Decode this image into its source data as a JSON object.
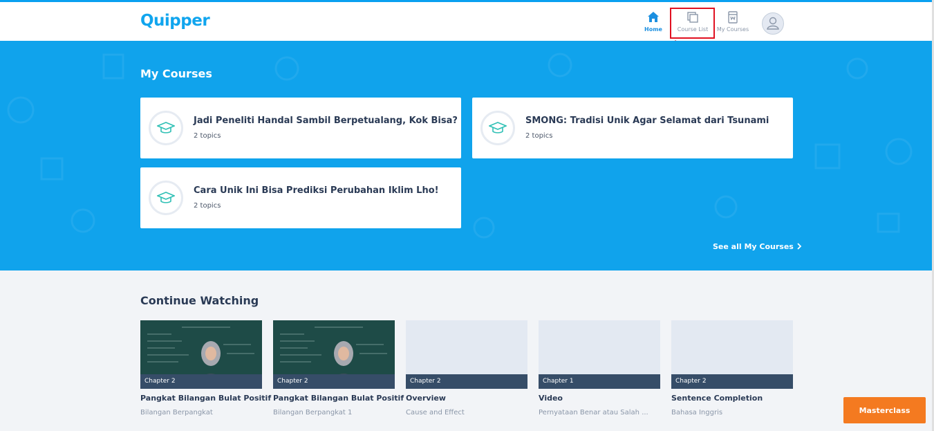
{
  "header": {
    "logo": "Quipper",
    "nav": [
      {
        "label": "Home",
        "icon": "home-icon",
        "active": true
      },
      {
        "label": "Course List",
        "icon": "course-list-icon",
        "highlighted": true
      },
      {
        "label": "My Courses",
        "icon": "my-courses-icon"
      }
    ],
    "avatar_icon": "user-avatar-icon"
  },
  "my_courses": {
    "title": "My Courses",
    "cards": [
      {
        "title": "Jadi Peneliti Handal Sambil Berpetualang, Kok Bisa?",
        "topics": "2 topics",
        "icon": "graduation-cap-icon"
      },
      {
        "title": "SMONG: Tradisi Unik Agar Selamat dari Tsunami",
        "topics": "2 topics",
        "icon": "graduation-cap-icon"
      },
      {
        "title": "Cara Unik Ini Bisa Prediksi Perubahan Iklim Lho!",
        "topics": "2 topics",
        "icon": "graduation-cap-icon"
      }
    ],
    "see_all": "See all My Courses",
    "see_all_icon": "chevron-right-icon"
  },
  "continue_watching": {
    "title": "Continue Watching",
    "videos": [
      {
        "chapter": "Chapter 2",
        "title": "Pangkat Bilangan Bulat Positif",
        "subtitle": "Bilangan Berpangkat",
        "thumbnail": "video-thumbnail"
      },
      {
        "chapter": "Chapter 2",
        "title": "Pangkat Bilangan Bulat Positif",
        "subtitle": "Bilangan Berpangkat 1",
        "thumbnail": "video-thumbnail"
      },
      {
        "chapter": "Chapter 2",
        "title": "Overview",
        "subtitle": "Cause and Effect",
        "thumbnail": "placeholder"
      },
      {
        "chapter": "Chapter 1",
        "title": "Video",
        "subtitle": "Pernyataan Benar atau Salah ...",
        "thumbnail": "placeholder"
      },
      {
        "chapter": "Chapter 2",
        "title": "Sentence Completion",
        "subtitle": "Bahasa Inggris",
        "thumbnail": "placeholder"
      }
    ]
  },
  "masterclass_button": "Masterclass",
  "colors": {
    "brand_blue": "#10a3ec",
    "accent_orange": "#f47a20",
    "highlight_red": "#e01020",
    "text_dark": "#2a3a55"
  }
}
